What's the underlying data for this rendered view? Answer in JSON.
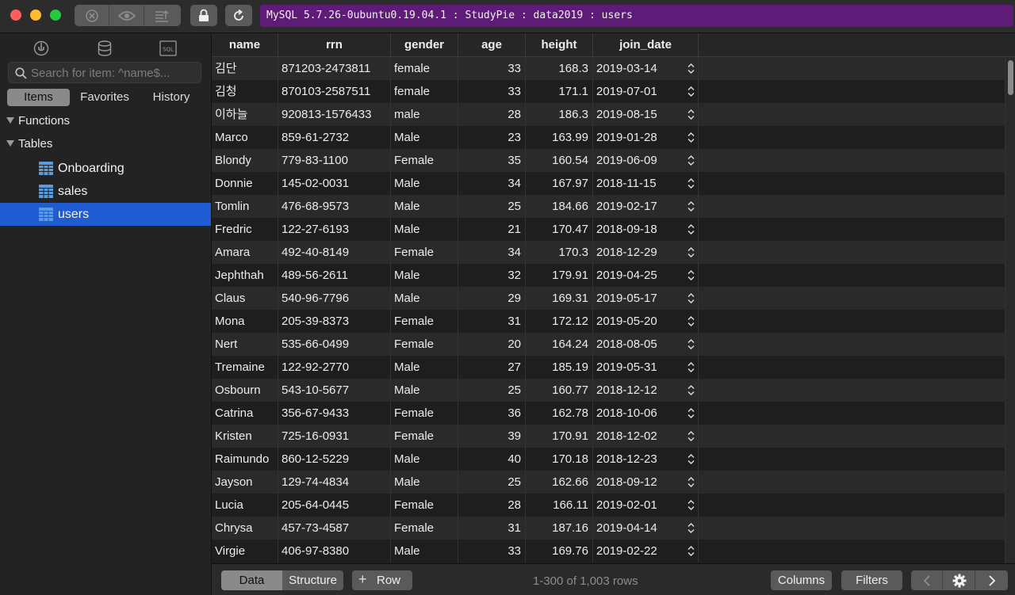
{
  "window": {
    "connection_title": "MySQL 5.7.26-0ubuntu0.19.04.1 : StudyPie : data2019 : users",
    "toolbar_icons": [
      "stop-icon",
      "eye-icon",
      "export-icon",
      "lock-icon",
      "refresh-icon"
    ]
  },
  "sidebar": {
    "search_placeholder": "Search for item: ^name$...",
    "tabs": [
      "Items",
      "Favorites",
      "History"
    ],
    "active_tab": "Items",
    "sections": {
      "functions": "Functions",
      "tables": "Tables"
    },
    "tables": [
      {
        "label": "Onboarding",
        "selected": false
      },
      {
        "label": "sales",
        "selected": false
      },
      {
        "label": "users",
        "selected": true
      }
    ],
    "top_icons": [
      "plug-icon",
      "database-icon",
      "sql-icon"
    ],
    "sql_icon_text": "SQL"
  },
  "grid": {
    "columns": [
      "name",
      "rrn",
      "gender",
      "age",
      "height",
      "join_date"
    ],
    "rows": [
      [
        "김단",
        "871203-2473811",
        "female",
        "33",
        "168.3",
        "2019-03-14"
      ],
      [
        "김청",
        "870103-2587511",
        "female",
        "33",
        "171.1",
        "2019-07-01"
      ],
      [
        "이하늘",
        "920813-1576433",
        "male",
        "28",
        "186.3",
        "2019-08-15"
      ],
      [
        "Marco",
        "859-61-2732",
        "Male",
        "23",
        "163.99",
        "2019-01-28"
      ],
      [
        "Blondy",
        "779-83-1100",
        "Female",
        "35",
        "160.54",
        "2019-06-09"
      ],
      [
        "Donnie",
        "145-02-0031",
        "Male",
        "34",
        "167.97",
        "2018-11-15"
      ],
      [
        "Tomlin",
        "476-68-9573",
        "Male",
        "25",
        "184.66",
        "2019-02-17"
      ],
      [
        "Fredric",
        "122-27-6193",
        "Male",
        "21",
        "170.47",
        "2018-09-18"
      ],
      [
        "Amara",
        "492-40-8149",
        "Female",
        "34",
        "170.3",
        "2018-12-29"
      ],
      [
        "Jephthah",
        "489-56-2611",
        "Male",
        "32",
        "179.91",
        "2019-04-25"
      ],
      [
        "Claus",
        "540-96-7796",
        "Male",
        "29",
        "169.31",
        "2019-05-17"
      ],
      [
        "Mona",
        "205-39-8373",
        "Female",
        "31",
        "172.12",
        "2019-05-20"
      ],
      [
        "Nert",
        "535-66-0499",
        "Female",
        "20",
        "164.24",
        "2018-08-05"
      ],
      [
        "Tremaine",
        "122-92-2770",
        "Male",
        "27",
        "185.19",
        "2019-05-31"
      ],
      [
        "Osbourn",
        "543-10-5677",
        "Male",
        "25",
        "160.77",
        "2018-12-12"
      ],
      [
        "Catrina",
        "356-67-9433",
        "Female",
        "36",
        "162.78",
        "2018-10-06"
      ],
      [
        "Kristen",
        "725-16-0931",
        "Female",
        "39",
        "170.91",
        "2018-12-02"
      ],
      [
        "Raimundo",
        "860-12-5229",
        "Male",
        "40",
        "170.18",
        "2018-12-23"
      ],
      [
        "Jayson",
        "129-74-4834",
        "Male",
        "25",
        "162.66",
        "2018-09-12"
      ],
      [
        "Lucia",
        "205-64-0445",
        "Female",
        "28",
        "166.11",
        "2019-02-01"
      ],
      [
        "Chrysa",
        "457-73-4587",
        "Female",
        "31",
        "187.16",
        "2019-04-14"
      ],
      [
        "Virgie",
        "406-97-8380",
        "Male",
        "33",
        "169.76",
        "2019-02-22"
      ]
    ]
  },
  "bottom_bar": {
    "view_tabs": [
      "Data",
      "Structure"
    ],
    "active_view": "Data",
    "add_row_label": "Row",
    "row_count": "1-300 of 1,003 rows",
    "columns_label": "Columns",
    "filters_label": "Filters"
  },
  "colors": {
    "connection_bar": "#5e1b78",
    "selection": "#1f5bd1",
    "close": "#fe5f57",
    "minimize": "#febc2e",
    "zoom": "#28c840"
  }
}
